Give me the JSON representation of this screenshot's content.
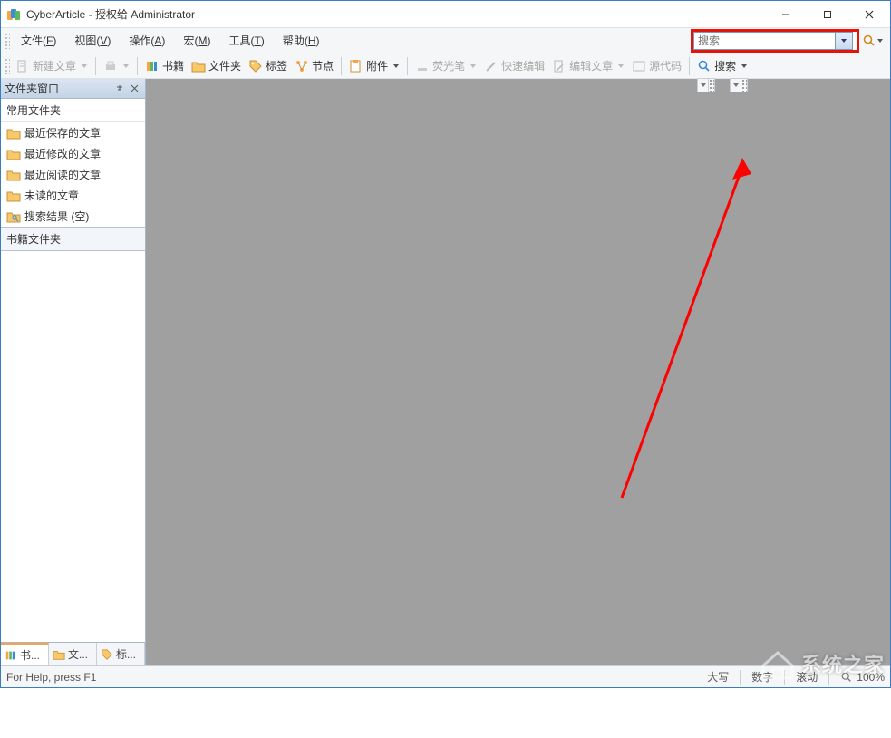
{
  "titlebar": {
    "title": "CyberArticle - 授权给 Administrator"
  },
  "menubar": {
    "items": [
      {
        "label": "文件",
        "accel": "F"
      },
      {
        "label": "视图",
        "accel": "V"
      },
      {
        "label": "操作",
        "accel": "A"
      },
      {
        "label": "宏",
        "accel": "M"
      },
      {
        "label": "工具",
        "accel": "T"
      },
      {
        "label": "帮助",
        "accel": "H"
      }
    ],
    "search_placeholder": "搜索"
  },
  "toolbar": {
    "new_doc": "新建文章",
    "books": "书籍",
    "folders": "文件夹",
    "tags": "标签",
    "nodes": "节点",
    "attachments": "附件",
    "highlighter": "荧光笔",
    "quick_edit": "快速编辑",
    "edit_article": "编辑文章",
    "source": "源代码",
    "search": "搜索"
  },
  "sidebar": {
    "pane_title": "文件夹窗口",
    "common_folders_header": "常用文件夹",
    "items": [
      "最近保存的文章",
      "最近修改的文章",
      "最近阅读的文章",
      "未读的文章",
      "搜索结果 (空)"
    ],
    "book_folders_header": "书籍文件夹",
    "tabs": [
      {
        "label": "书..."
      },
      {
        "label": "文..."
      },
      {
        "label": "标..."
      }
    ]
  },
  "statusbar": {
    "help": "For Help, press F1",
    "caps": "大写",
    "num": "数字",
    "scroll": "滚动",
    "zoom": "100%"
  },
  "watermark": {
    "text": "系统之家"
  }
}
